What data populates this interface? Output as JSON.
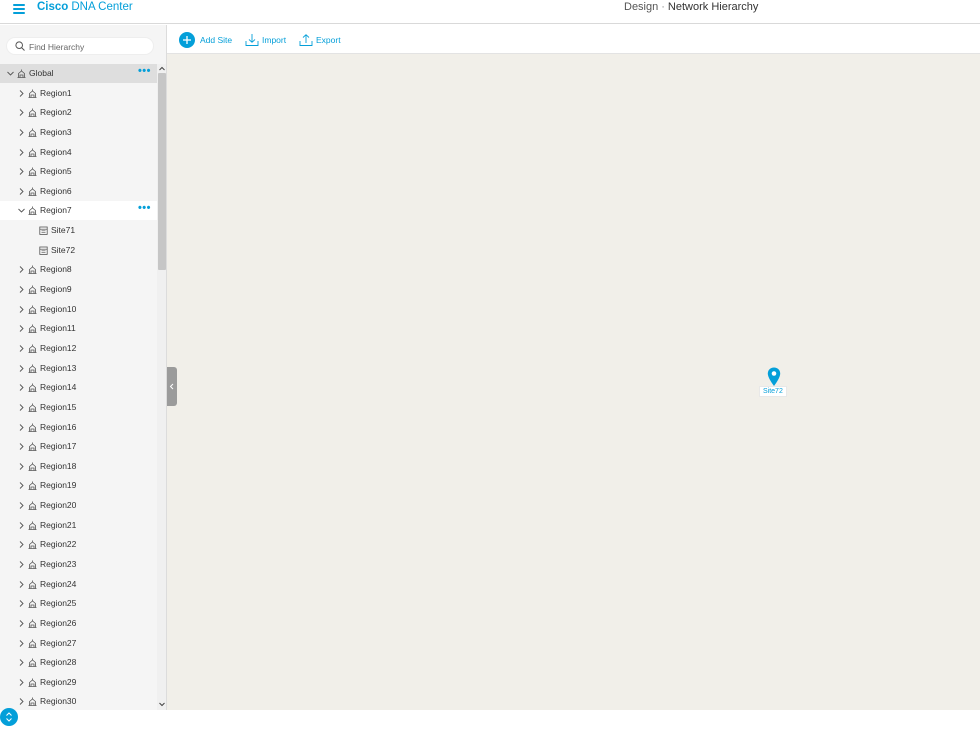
{
  "header": {
    "brand_bold": "Cisco",
    "brand_rest": "DNA Center",
    "section": "Design",
    "separator": "·",
    "page": "Network Hierarchy",
    "menu_icon": "hamburger-menu-icon"
  },
  "search": {
    "placeholder": "Find Hierarchy",
    "value": ""
  },
  "tree": {
    "root": {
      "label": "Global",
      "expanded": true,
      "selected": true
    },
    "regions": [
      "Region1",
      "Region2",
      "Region3",
      "Region4",
      "Region5",
      "Region6",
      "Region7",
      "Region8",
      "Region9",
      "Region10",
      "Region11",
      "Region12",
      "Region13",
      "Region14",
      "Region15",
      "Region16",
      "Region17",
      "Region18",
      "Region19",
      "Region20",
      "Region21",
      "Region22",
      "Region23",
      "Region24",
      "Region25",
      "Region26",
      "Region27",
      "Region28",
      "Region29",
      "Region30"
    ],
    "expanded_region": "Region7",
    "sites": [
      "Site71",
      "Site72"
    ],
    "more_actions": "•••"
  },
  "toolbar": {
    "add_site": "Add Site",
    "import": "Import",
    "export": "Export"
  },
  "map": {
    "pin_label": "Site72"
  },
  "colors": {
    "accent": "#049fd9",
    "map_bg": "#f1efe9",
    "sidebar_bg": "#f5f5f5",
    "selected_row": "#dedede"
  }
}
